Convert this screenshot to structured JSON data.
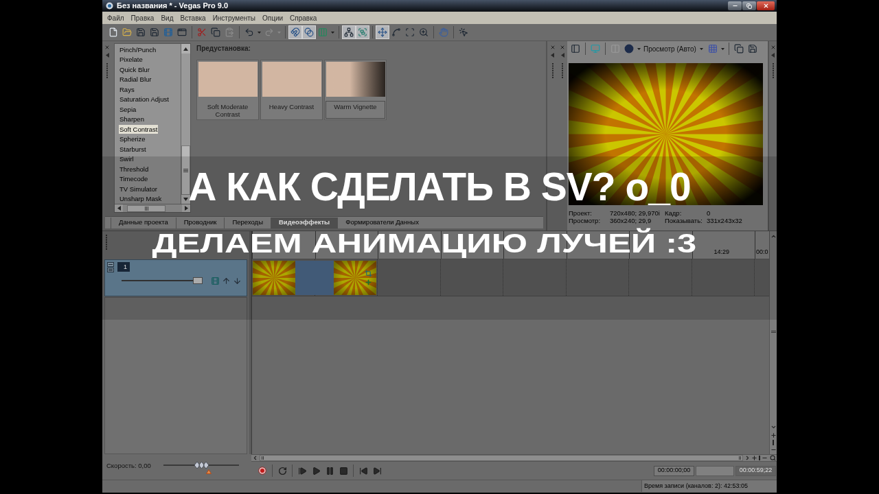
{
  "window": {
    "title": "Без названия * - Vegas Pro 9.0"
  },
  "menu": [
    "Файл",
    "Правка",
    "Вид",
    "Вставка",
    "Инструменты",
    "Опции",
    "Справка"
  ],
  "toolbar": [
    {
      "pressed": false,
      "disabled": false
    },
    {
      "pressed": false,
      "disabled": false
    },
    {
      "pressed": false,
      "disabled": false
    },
    {
      "pressed": false,
      "disabled": false
    },
    {
      "pressed": false,
      "disabled": false
    },
    {
      "pressed": false,
      "disabled": false
    },
    {
      "pressed": false,
      "disabled": false
    },
    {
      "pressed": false,
      "disabled": false
    },
    {
      "pressed": false,
      "disabled": true
    },
    {
      "pressed": false,
      "disabled": false
    },
    {
      "pressed": false,
      "disabled": true
    },
    {
      "pressed": true,
      "disabled": false
    },
    {
      "pressed": true,
      "disabled": false
    },
    {
      "pressed": false,
      "disabled": false
    },
    {
      "pressed": true,
      "disabled": false
    },
    {
      "pressed": true,
      "disabled": false
    },
    {
      "pressed": true,
      "disabled": false
    },
    {
      "pressed": false,
      "disabled": false
    },
    {
      "pressed": false,
      "disabled": false
    },
    {
      "pressed": false,
      "disabled": false
    },
    {
      "pressed": false,
      "disabled": false
    },
    {
      "pressed": false,
      "disabled": false
    }
  ],
  "effects": {
    "items": [
      {
        "label": "Pinch/Punch",
        "selected": false
      },
      {
        "label": "Pixelate",
        "selected": false
      },
      {
        "label": "Quick Blur",
        "selected": false
      },
      {
        "label": "Radial Blur",
        "selected": false
      },
      {
        "label": "Rays",
        "selected": false
      },
      {
        "label": "Saturation Adjust",
        "selected": false
      },
      {
        "label": "Sepia",
        "selected": false
      },
      {
        "label": "Sharpen",
        "selected": false
      },
      {
        "label": "Soft Contrast",
        "selected": true
      },
      {
        "label": "Spherize",
        "selected": false
      },
      {
        "label": "Starburst",
        "selected": false
      },
      {
        "label": "Swirl",
        "selected": false
      },
      {
        "label": "Threshold",
        "selected": false
      },
      {
        "label": "Timecode",
        "selected": false
      },
      {
        "label": "TV Simulator",
        "selected": false
      },
      {
        "label": "Unsharp Mask",
        "selected": false
      }
    ]
  },
  "presets": {
    "label": "Предустановка:",
    "items": [
      {
        "label": "Soft Moderate Contrast",
        "selected": false
      },
      {
        "label": "Heavy Contrast",
        "selected": false
      },
      {
        "label": "Warm Vignette",
        "selected": true
      }
    ]
  },
  "dock_tabs": [
    {
      "label": "Данные проекта",
      "selected": false
    },
    {
      "label": "Проводник",
      "selected": false
    },
    {
      "label": "Переходы",
      "selected": false
    },
    {
      "label": "Видеоэффекты",
      "selected": true
    },
    {
      "label": "Формирователи Данных",
      "selected": false
    }
  ],
  "preview": {
    "tools": [
      {
        "disabled": false
      },
      {
        "disabled": false
      },
      {
        "disabled": true
      },
      {
        "disabled": false
      },
      {
        "disabled": false
      },
      {
        "disabled": false
      },
      {
        "disabled": false
      }
    ],
    "quality": "Просмотр (Авто)",
    "info": [
      {
        "label": "Проект:",
        "value": "720x480; 29,970i",
        "label_2": "Кадр:",
        "value_2": "0"
      },
      {
        "label": "Просмотр:",
        "value": "360x240; 29,9",
        "label_2": "Показывать:",
        "value_2": "331x243x32"
      }
    ]
  },
  "timeline": {
    "ruler_labels": [
      "14:29",
      "00:0"
    ],
    "tracks": [
      {
        "number": "1",
        "level": 1
      }
    ]
  },
  "speed": {
    "label": "Скорость: 0,00",
    "level": 0.5
  },
  "time_fields": {
    "cursor": "00:00:00;00",
    "length": "00:00:59;22"
  },
  "status_bar": {
    "record_time": "Время записи (каналов: 2): 42:53:05"
  },
  "caption": {
    "lines": [
      "А КАК СДЕЛАТЬ В SV? o_0",
      "ДЕЛАЕМ АНИМАЦИЮ ЛУЧЕЙ :3"
    ]
  }
}
